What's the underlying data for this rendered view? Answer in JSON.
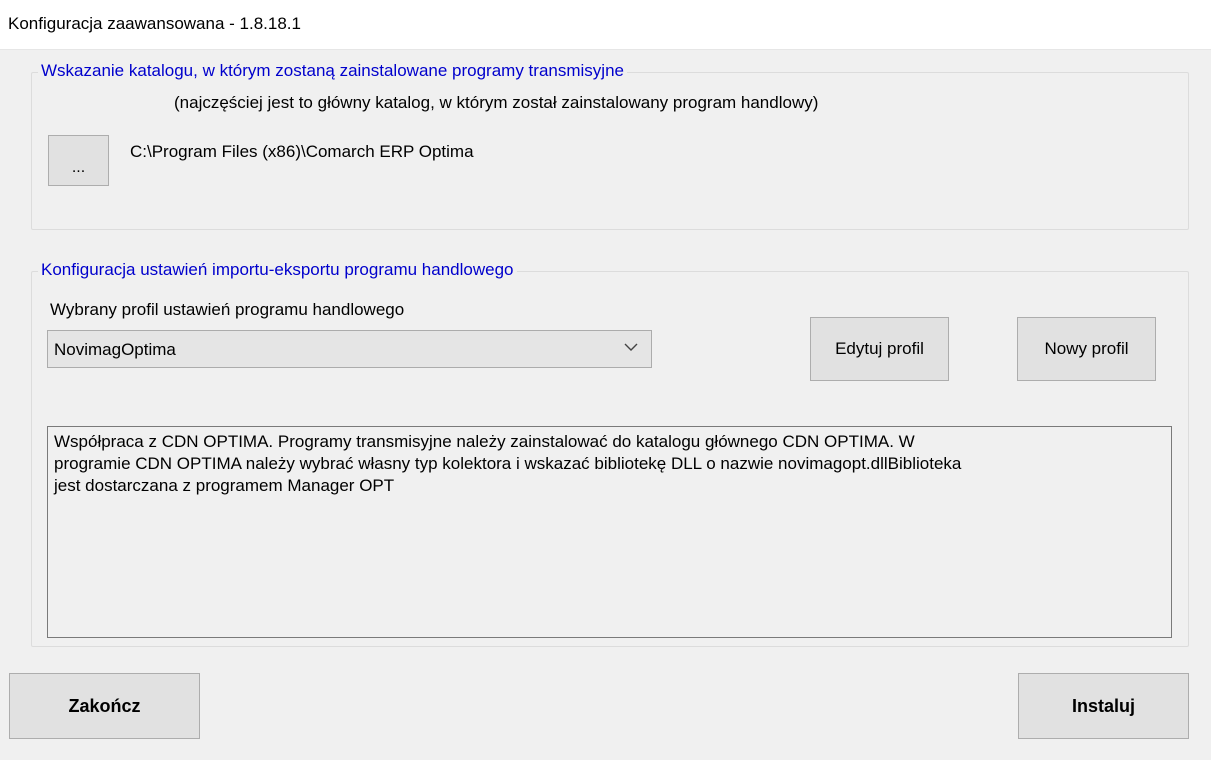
{
  "window": {
    "title": "Konfiguracja zaawansowana - 1.8.18.1"
  },
  "directory_group": {
    "legend": "Wskazanie katalogu, w którym zostaną zainstalowane programy transmisyjne",
    "hint": "(najczęściej jest to główny katalog, w którym został zainstalowany program handlowy)",
    "browse_label": "...",
    "path": "C:\\Program Files (x86)\\Comarch ERP Optima"
  },
  "config_group": {
    "legend": "Konfiguracja ustawień importu-eksportu programu handlowego",
    "profile_label": "Wybrany profil ustawień programu handlowego",
    "profile_selected": "NovimagOptima",
    "edit_label": "Edytuj profil",
    "new_label": "Nowy profil",
    "description": "Współpraca z CDN OPTIMA. Programy transmisyjne należy zainstalować do katalogu głównego CDN OPTIMA. W\nprogramie CDN OPTIMA należy wybrać własny typ kolektora i wskazać bibliotekę DLL o nazwie novimagopt.dllBiblioteka\njest dostarczana z programem Manager OPT"
  },
  "footer": {
    "close_label": "Zakończ",
    "install_label": "Instaluj"
  },
  "icons": {
    "dropdown": "chevron-down-icon"
  },
  "colors": {
    "legend": "#0000cc",
    "background": "#f0f0f0",
    "button": "#e1e1e1"
  }
}
